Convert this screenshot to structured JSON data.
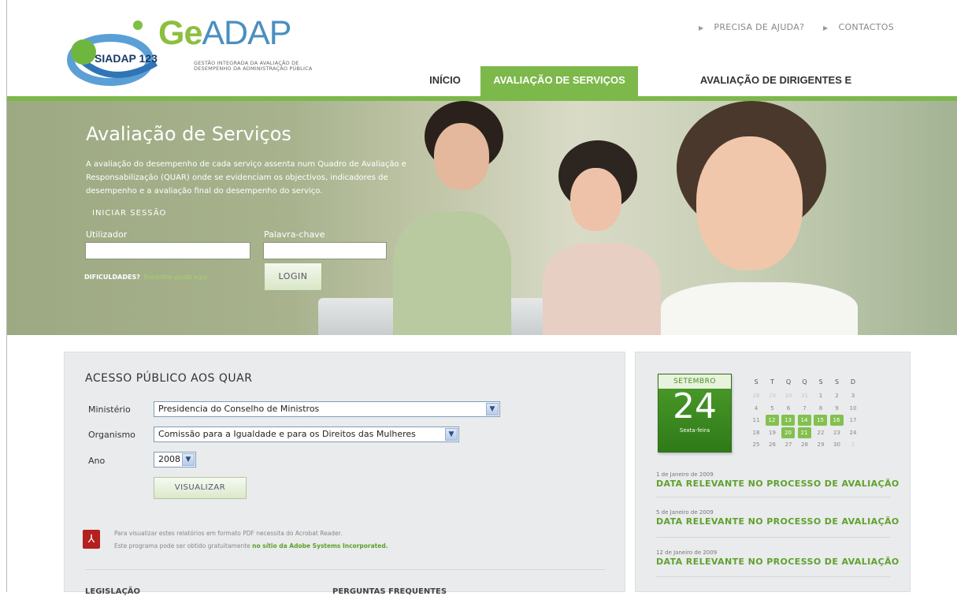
{
  "brand": {
    "ge": "Ge",
    "adap": "ADAP",
    "tagline": "GESTÃO INTEGRADA DA AVALIAÇÃO DE DESEMPENHO DA ADMINISTRAÇÃO PÚBLICA",
    "siadap": "SIADAP 123"
  },
  "toplinks": {
    "help": "PRECISA DE AJUDA?",
    "contacts": "CONTACTOS"
  },
  "nav": {
    "inicio": "INÍCIO",
    "servicos": "AVALIAÇÃO DE SERVIÇOS",
    "dirigentes": "AVALIAÇÃO DE DIRIGENTES E TRABALHADORES"
  },
  "hero": {
    "title": "Avaliação de Serviços",
    "description": "A avaliação do desempenho de cada serviço assenta num Quadro de Avaliação e Responsabilização (QUAR) onde se evidenciam os objectivos, indicadores de desempenho e a avaliação final do desempenho do serviço.",
    "session": "INICIAR SESSÃO",
    "user_label": "Utilizador",
    "password_label": "Palavra-chave",
    "login": "LOGIN",
    "difficulties": "DIFICULDADES?",
    "help_link": "Encontre ajuda aqui."
  },
  "quar": {
    "title": "ACESSO PÚBLICO AOS QUAR",
    "ministerio_label": "Ministério",
    "ministerio_value": "Presidencia do Conselho de Ministros",
    "organismo_label": "Organismo",
    "organismo_value": "Comissão para a Igualdade e para os Direitos das Mulheres",
    "ano_label": "Ano",
    "ano_value": "2008",
    "visualize": "VISUALIZAR",
    "pdf_line1": "Para visualizar estes relatórios em formato PDF necessita do Acrobat Reader.",
    "pdf_line2": "Este programa pode ser obtido gratuitamente",
    "pdf_link": "no sítio da Adobe Systems Incorporated.",
    "bottom_left": "LEGISLAÇÃO",
    "bottom_right": "PERGUNTAS FREQUENTES"
  },
  "calendar": {
    "month": "SETEMBRO",
    "day": "24",
    "weekday": "Sexta-feira",
    "headers": [
      "S",
      "T",
      "Q",
      "Q",
      "S",
      "S",
      "D"
    ],
    "rows": [
      [
        {
          "d": "28",
          "s": "dim"
        },
        {
          "d": "29",
          "s": "dim"
        },
        {
          "d": "30",
          "s": "dim"
        },
        {
          "d": "31",
          "s": "dim"
        },
        {
          "d": "1",
          "s": ""
        },
        {
          "d": "2",
          "s": ""
        },
        {
          "d": "3",
          "s": ""
        }
      ],
      [
        {
          "d": "4",
          "s": ""
        },
        {
          "d": "5",
          "s": ""
        },
        {
          "d": "6",
          "s": ""
        },
        {
          "d": "7",
          "s": ""
        },
        {
          "d": "8",
          "s": ""
        },
        {
          "d": "9",
          "s": ""
        },
        {
          "d": "10",
          "s": ""
        }
      ],
      [
        {
          "d": "11",
          "s": ""
        },
        {
          "d": "12",
          "s": "hl"
        },
        {
          "d": "13",
          "s": "hl"
        },
        {
          "d": "14",
          "s": "hl"
        },
        {
          "d": "15",
          "s": "hl"
        },
        {
          "d": "16",
          "s": "hl"
        },
        {
          "d": "17",
          "s": ""
        }
      ],
      [
        {
          "d": "18",
          "s": ""
        },
        {
          "d": "19",
          "s": ""
        },
        {
          "d": "20",
          "s": "hl"
        },
        {
          "d": "21",
          "s": "hl"
        },
        {
          "d": "22",
          "s": ""
        },
        {
          "d": "23",
          "s": ""
        },
        {
          "d": "24",
          "s": ""
        }
      ],
      [
        {
          "d": "25",
          "s": ""
        },
        {
          "d": "26",
          "s": ""
        },
        {
          "d": "27",
          "s": ""
        },
        {
          "d": "28",
          "s": ""
        },
        {
          "d": "29",
          "s": ""
        },
        {
          "d": "30",
          "s": ""
        },
        {
          "d": "1",
          "s": "dim"
        }
      ]
    ]
  },
  "events": [
    {
      "date": "1 de Janeiro de 2009",
      "title": "DATA RELEVANTE NO PROCESSO DE AVALIAÇÃO"
    },
    {
      "date": "5 de Janeiro de 2009",
      "title": "DATA RELEVANTE NO PROCESSO DE AVALIAÇÃO"
    },
    {
      "date": "12 de Janeiro de 2009",
      "title": "DATA RELEVANTE NO PROCESSO DE AVALIAÇÃO"
    }
  ],
  "colors": {
    "accent": "#7cb84a",
    "link": "#5fa12e",
    "panel": "#e9ebec"
  }
}
